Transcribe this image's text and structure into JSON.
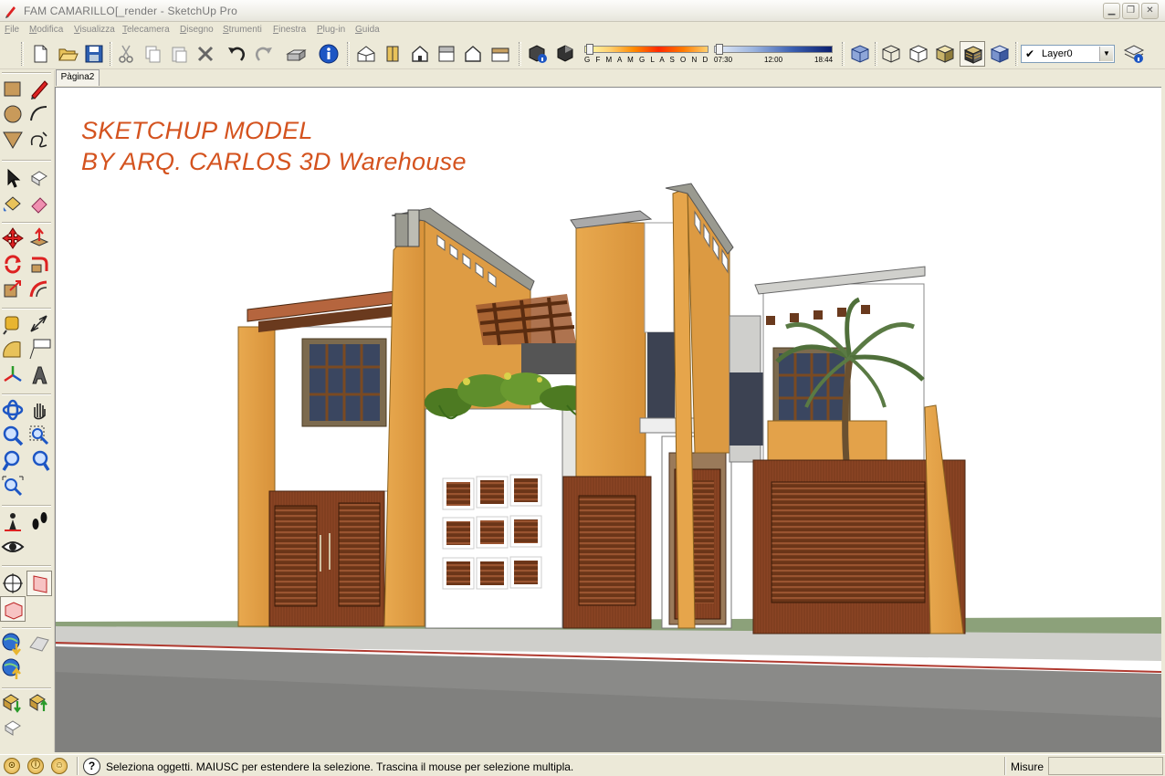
{
  "window": {
    "title": "FAM CAMARILLO[_render - SketchUp Pro"
  },
  "menu": [
    "File",
    "Modifica",
    "Visualizza",
    "Telecamera",
    "Disegno",
    "Strumenti",
    "Finestra",
    "Plug-in",
    "Guida"
  ],
  "shadow": {
    "months_label": "G F M A M G L A S O N D",
    "time_start": "07:30",
    "time_mid": "12:00",
    "time_end": "18:44"
  },
  "layer": {
    "current": "Layer0",
    "check": "✔"
  },
  "scene_tab": "Pàgina2",
  "viewport": {
    "overlay_line1": "SKETCHUP MODEL",
    "overlay_line2": "BY ARQ. CARLOS  3D Warehouse"
  },
  "status": {
    "message": "Seleziona oggetti. MAIUSC per estendere la selezione. Trascina il mouse per selezione multipla.",
    "measurements_label": "Misure",
    "measurements_value": ""
  },
  "colors": {
    "overlay_text": "#d4531f",
    "ochre_wall": "#e3a24a",
    "wood": "#7a3e1f",
    "ui_bg": "#ece9d8"
  },
  "icons": {
    "status": [
      "geo-location-icon",
      "credits-icon",
      "user-icon"
    ],
    "help": "help-icon"
  }
}
